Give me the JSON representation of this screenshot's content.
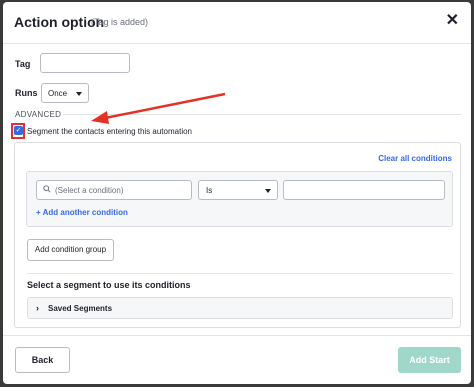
{
  "modal": {
    "title": "Action option",
    "subtitle": "(Tag is added)",
    "close_icon": "close-icon",
    "close_glyph": "✕"
  },
  "form": {
    "tag_label": "Tag",
    "tag_value": "",
    "runs_label": "Runs",
    "runs_selected": "Once",
    "advanced_label": "ADVANCED",
    "segment_checkbox_checked": true,
    "segment_checkbox_label": "Segment the contacts entering this automation"
  },
  "segment": {
    "clear_all_label": "Clear all conditions",
    "condition_placeholder": "(Select a condition)",
    "operator_selected": "Is",
    "value": "",
    "add_condition_label": "+ Add another condition",
    "add_group_label": "Add condition group",
    "saved_heading": "Select a segment to use its conditions",
    "saved_segments_label": "Saved Segments"
  },
  "footer": {
    "back_label": "Back",
    "add_start_label": "Add Start"
  },
  "colors": {
    "accent_blue": "#356ae6",
    "annotation_red": "#e53228",
    "disabled_green": "#9fd8c9"
  }
}
